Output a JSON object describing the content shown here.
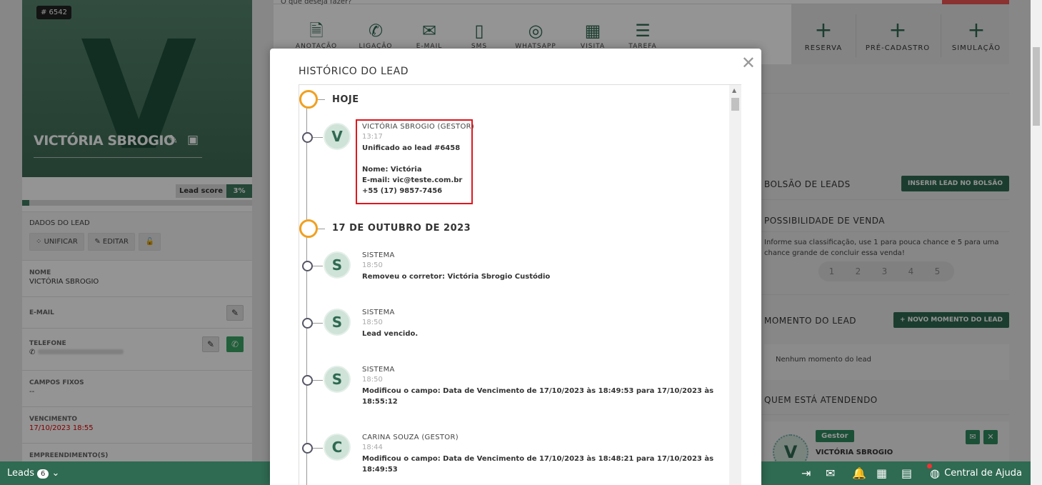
{
  "lead": {
    "id_badge": "# 6542",
    "initial": "V",
    "name": "VICTÓRIA SBROGIO",
    "score_label": "Lead score",
    "score_value": "3%",
    "score_fraction": 0.03,
    "section_title": "DADOS DO LEAD",
    "btn_unify": "UNIFICAR",
    "btn_edit": "EDITAR",
    "fields": {
      "name_label": "NOME",
      "name_value": "VICTÓRIA SBROGIO",
      "email_label": "E-MAIL",
      "phone_label": "TELEFONE",
      "fixed_label": "CAMPOS FIXOS",
      "fixed_value": "--",
      "due_label": "VENCIMENTO",
      "due_value": "17/10/2023 18:55",
      "projects_label": "EMPREENDIMENTO(S)"
    }
  },
  "toolbar": {
    "search_hint": "O que deseja fazer?",
    "actions": [
      "ANOTAÇÃO",
      "LIGAÇÃO",
      "E-MAIL",
      "SMS",
      "WHATSAPP",
      "VISITA",
      "TAREFA"
    ],
    "plus": [
      "RESERVA",
      "PRÉ-CADASTRO",
      "SIMULAÇÃO"
    ]
  },
  "right": {
    "pool_title": "BOLSÃO DE LEADS",
    "pool_btn": "INSERIR LEAD NO BOLSÃO",
    "sale_title": "POSSIBILIDADE DE VENDA",
    "sale_hint": "Informe sua classificação, use 1 para pouca chance e 5 para uma chance grande de concluir essa venda!",
    "ratings": [
      "1",
      "2",
      "3",
      "4",
      "5"
    ],
    "moment_title": "MOMENTO DO LEAD",
    "moment_btn": "+ NOVO MOMENTO DO LEAD",
    "moment_empty": "Nenhum momento do lead",
    "attending_title": "QUEM ESTÁ ATENDENDO",
    "attending_badge": "Gestor",
    "attending_initial": "V",
    "attending_name": "VICTÓRIA SBROGIO"
  },
  "bottom": {
    "leads_label": "Leads",
    "leads_count": "6",
    "help": "Central de Ajuda"
  },
  "modal": {
    "title": "HISTÓRICO DO LEAD",
    "day1": "HOJE",
    "day2": "17 DE OUTUBRO DE 2023",
    "events": [
      {
        "initial": "V",
        "author": "VICTÓRIA SBROGIO (GESTOR)",
        "time": "13:17",
        "l1": "Unificado ao lead #6458",
        "l2": "Nome: Victória",
        "l3": "E-mail: vic@teste.com.br",
        "l4": "+55 (17) 9857-7456"
      },
      {
        "initial": "S",
        "author": "SISTEMA",
        "time": "18:50",
        "l1": "Removeu o corretor: Victória Sbrogio Custódio"
      },
      {
        "initial": "S",
        "author": "SISTEMA",
        "time": "18:50",
        "l1": "Lead vencido."
      },
      {
        "initial": "S",
        "author": "SISTEMA",
        "time": "18:50",
        "l1": "Modificou o campo: Data de Vencimento de 17/10/2023 às 18:49:53 para 17/10/2023 às 18:55:12"
      },
      {
        "initial": "C",
        "author": "CARINA SOUZA (GESTOR)",
        "time": "18:44",
        "l1": "Modificou o campo: Data de Vencimento de 17/10/2023 às 18:48:21 para 17/10/2023 às 18:49:53"
      }
    ]
  },
  "colors": {
    "brand_green": "#2f6a52",
    "timeline_day": "#f0a020",
    "highlight": "#e0161e"
  }
}
